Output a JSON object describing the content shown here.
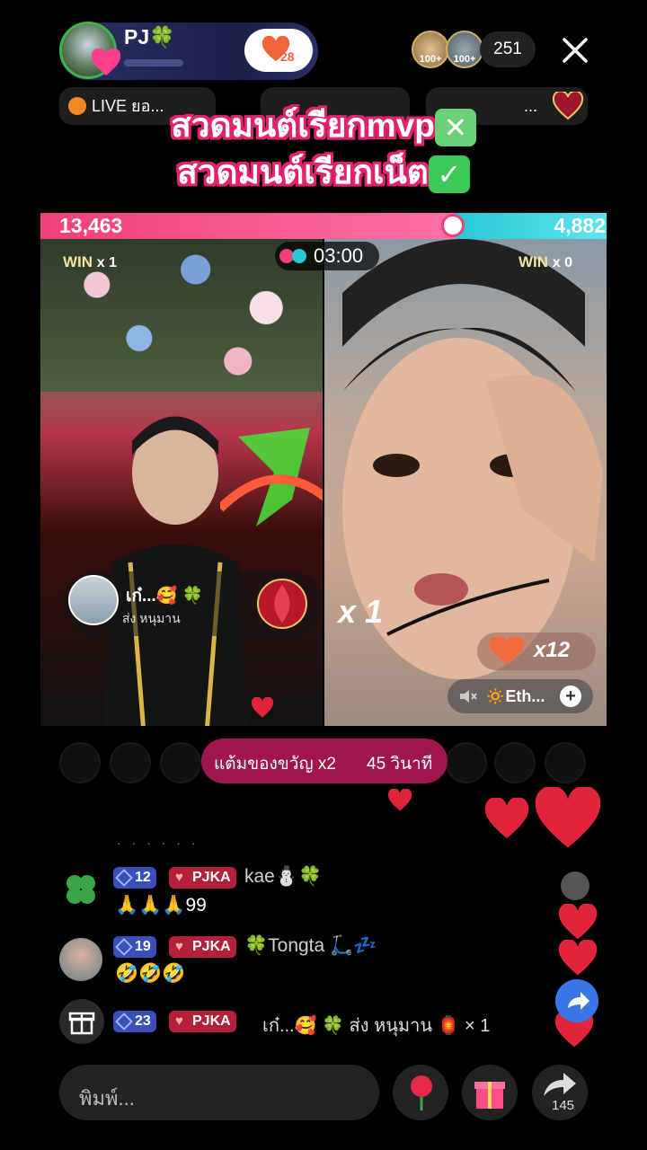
{
  "header": {
    "host_name": "PJ🍀",
    "follow_count": "28",
    "viewers": [
      {
        "badge": "100+"
      },
      {
        "badge": "100+"
      }
    ],
    "viewer_count": "251",
    "chips": [
      {
        "label": "LIVE ยอ..."
      },
      {
        "label": ""
      },
      {
        "label": "..."
      }
    ]
  },
  "banner": {
    "line1": "สวดมนต์เรียกmvp",
    "line1_mark": "✕",
    "line2": "สวดมนต์เรียกเน็ต",
    "line2_mark": "✓",
    "line1_mark_color": "#6ad07a",
    "line2_mark_color": "#3cc95a"
  },
  "battle": {
    "score_left": "13,463",
    "score_right": "4,882",
    "left_share": 0.734,
    "timer": "03:00",
    "win_left": {
      "label": "WIN",
      "count": "x 1"
    },
    "win_right": {
      "label": "WIN",
      "count": "x 0"
    },
    "colors": {
      "left": "#f0407a",
      "right": "#27c9d6"
    }
  },
  "left_stream": {
    "sender_name": "เก๋...🥰 🍀",
    "sender_action": "ส่ง หนุมาน"
  },
  "right_stream": {
    "multiplier": "x 1",
    "combo": "x12",
    "music": "🔅Eth..."
  },
  "gift_bonus": {
    "text": "แต้มของขวัญ x2",
    "time": "45 วินาที"
  },
  "chat": [
    {
      "level": "12",
      "fan": "PJKA",
      "user": "kae⛄🍀",
      "message": "🙏🙏🙏99"
    },
    {
      "level": "19",
      "fan": "PJKA",
      "user": "🍀Tongta 🛴💤",
      "message": "🤣🤣🤣"
    },
    {
      "level": "23",
      "fan": "PJKA",
      "user": "เก๋...🥰 🍀",
      "message": "ส่ง หนุมาน 🏮 × 1"
    }
  ],
  "bottom": {
    "input_placeholder": "พิมพ์...",
    "share_count": "145"
  },
  "icons": [
    "close-icon",
    "heart-icon",
    "gift-icon",
    "rose-icon",
    "share-icon",
    "mute-icon",
    "plus-icon",
    "clover-icon",
    "timer-icon"
  ]
}
